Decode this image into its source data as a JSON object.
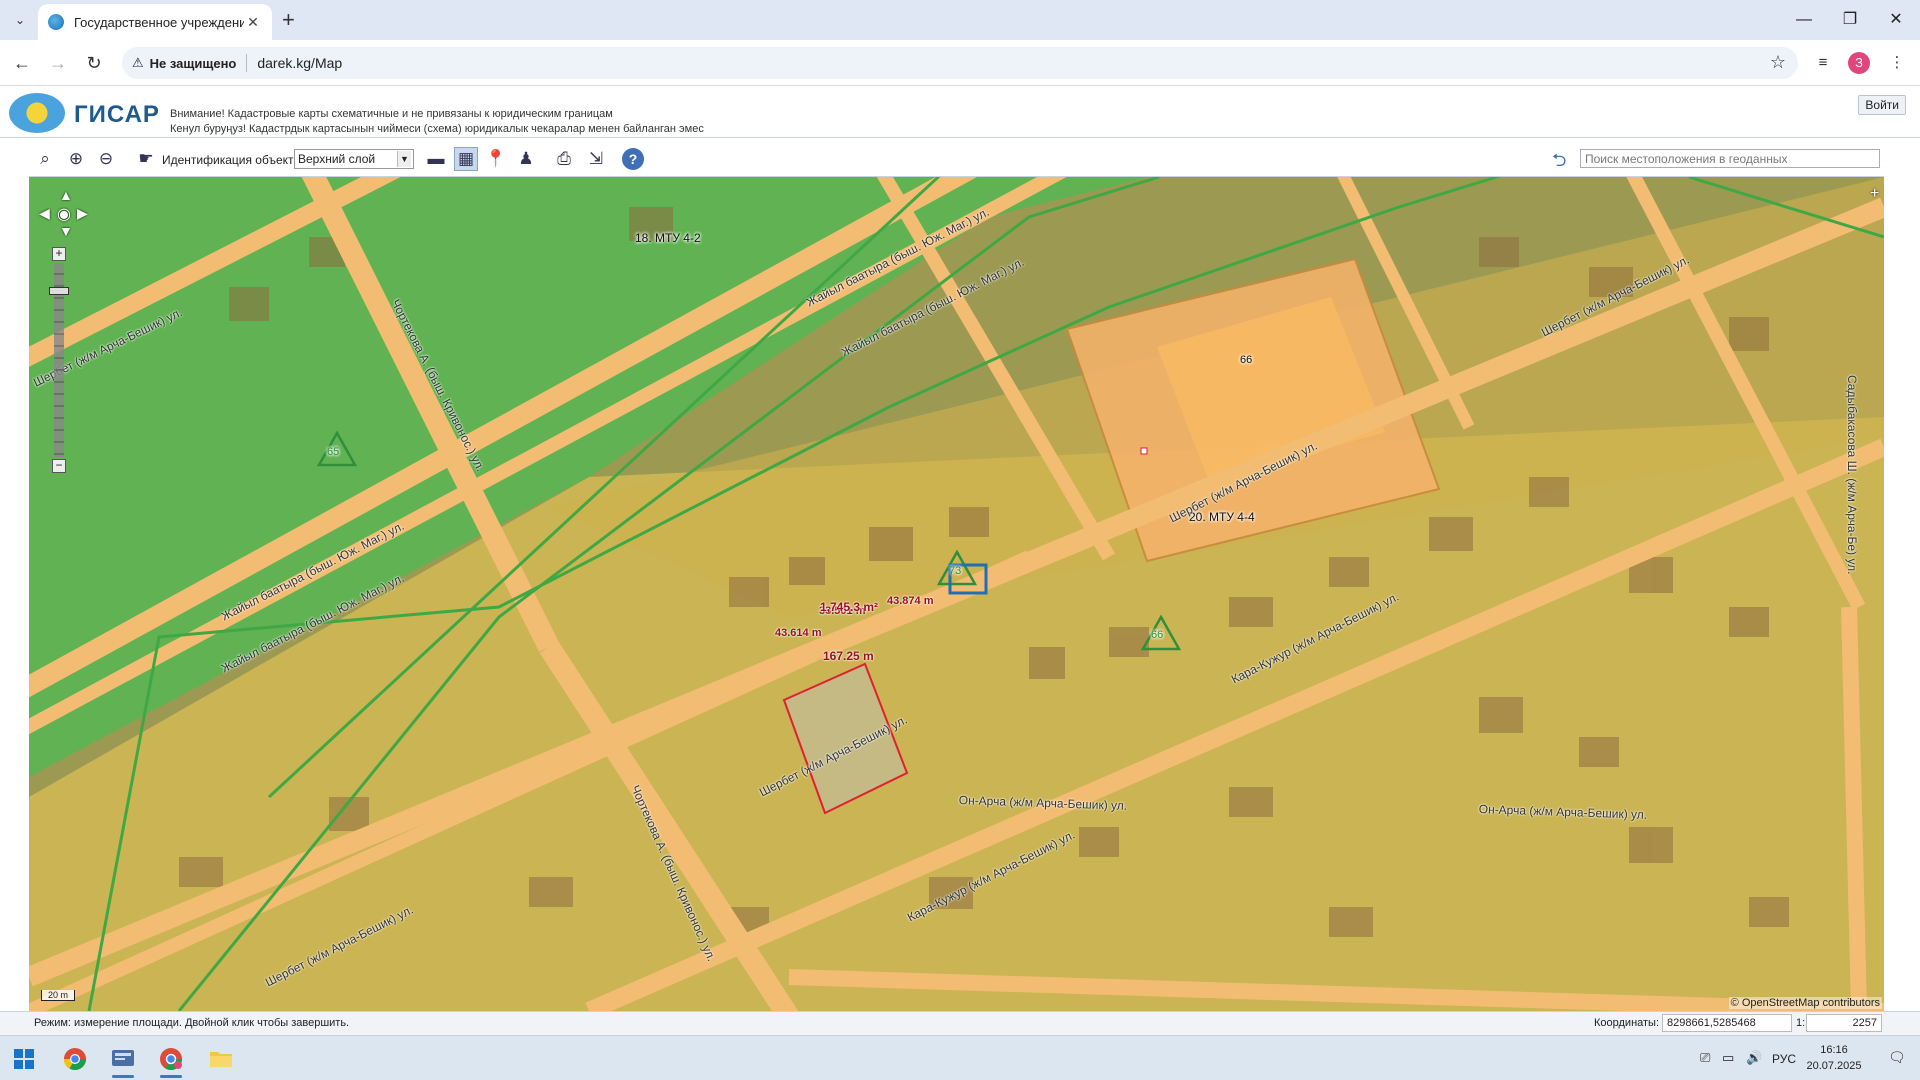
{
  "browser": {
    "tab_title": "Государственное учреждение",
    "tab_close": "✕",
    "new_tab": "+",
    "security_label": "Не защищено",
    "url": "darek.kg/Map",
    "window": {
      "minimize": "—",
      "restore": "❐",
      "close": "✕"
    },
    "avatar_letter": "З"
  },
  "app": {
    "logo_text": "ГИСАР",
    "notice_ru": "Внимание! Кадастровые карты схематичные и не привязаны к юридическим границам",
    "notice_kg": "Кенул буруңуз! Кадастрдык картасынын чиймеси (схема) юридикалык чекаралар менен байланган эмес",
    "login_label": "Войти"
  },
  "map_toolbar": {
    "collapse_left": "»",
    "collapse_right": "«",
    "ident_label": "Идентификация объекта:",
    "ident_selected": "Верхний слой",
    "help": "?",
    "search_placeholder": "Поиск местоположения в геоданных"
  },
  "map": {
    "scale_bar": "20 m",
    "attribution": "© OpenStreetMap contributors",
    "zones": {
      "z18": "18. МТУ 4-2",
      "z20": "20. МТУ 4-4",
      "parcel66": "66",
      "tri65": "65",
      "tri73": "73",
      "tri66": "66"
    },
    "streets": [
      "Шербет (ж/м Арча-Бешик) ул.",
      "Жайыл баатыра (быш. Юж. Маг.) ул.",
      "Жайыл баатыра (быш. Юж. Маг.) ул.",
      "Жайыл баатыра (быш. Юж. Маг.) ул.",
      "Жайыл баатыра (быш. Юж. Маг.) ул.",
      "Чортекова А. (быш. Кривонос.) ул.",
      "Шербет (ж/м Арча-Бешик) ул.",
      "Шербет (ж/м Арча-Бешик) ул.",
      "Шербет (ж/м Арча-Бешик) ул.",
      "Кара-Кужур (ж/м Арча-Бешик) ул.",
      "Кара-Кужур (ж/м Арча-Бешик) ул.",
      "Чортекова А. (быш. Кривонос.) ул.",
      "Шербет (ж/м Арча-Бешик) ул.",
      "Он-Арча (ж/м Арча-Бешик) ул.",
      "Он-Арча (ж/м Арча-Бешик) ул.",
      "Садыбакасова Ш. (ж/м Арча-Бе) ул."
    ],
    "measure": {
      "area": "1,745.3 m²",
      "top": "33.501 m",
      "right": "43.874 m",
      "left": "43.614 m",
      "perimeter": "167.25 m"
    }
  },
  "status": {
    "mode": "Режим: измерение площади. Двойной клик чтобы завершить.",
    "coord_label": "Координаты:",
    "coord_value": "8298661,5285468",
    "scale_label": "1:",
    "scale_value": "2257"
  },
  "taskbar": {
    "lang": "РУС",
    "time": "16:16",
    "date": "20.07.2025"
  },
  "colors": {
    "road": "#f2bd72",
    "zone_yellow": "#e0c35a",
    "zone_green": "#5fc25a",
    "parcel_orange": "#f3b26a",
    "boundary_green": "#3fa845",
    "measure_red": "#e02030",
    "accent_blue": "#1f6fb5"
  }
}
